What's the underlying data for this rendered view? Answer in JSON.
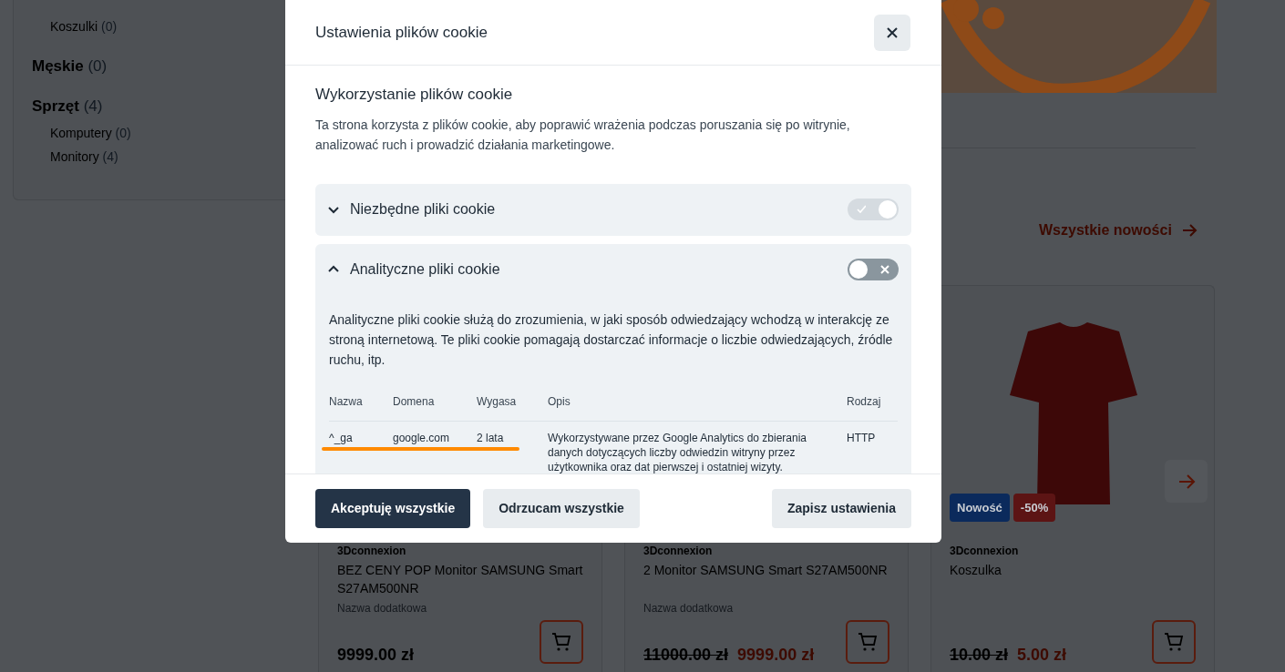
{
  "sidebar": {
    "categories": [
      {
        "children": [
          {
            "label": "Koszulki",
            "count": "(0)"
          }
        ]
      },
      {
        "label": "Męskie",
        "count": "(0)"
      },
      {
        "label": "Sprzęt",
        "count": "(4)",
        "children": [
          {
            "label": "Komputery",
            "count": "(0)"
          },
          {
            "label": "Monitory",
            "count": "(4)"
          }
        ]
      }
    ]
  },
  "new_products": {
    "link": "Wszystkie nowości",
    "products": [
      {
        "brand": "3Dconnexion",
        "name": "BEZ CENY POP Monitor SAMSUNG Smart S27AM500NR",
        "subtitle": "Nazwa dodatkowa",
        "price": "9999.00 zł"
      },
      {
        "brand": "3Dconnexion",
        "name": "2 Monitor SAMSUNG Smart S27AM500NR",
        "subtitle": "Nazwa dodatkowa",
        "old_price": "11000.00 zł",
        "price": "9999.00 zł"
      },
      {
        "brand": "3Dconnexion",
        "name": "Koszulka",
        "old_price": "10.00 zł",
        "price": "5.00 zł",
        "badges": [
          {
            "label": "Nowość",
            "color": "#0b2a5c"
          },
          {
            "label": "-50%",
            "color": "#5c1414"
          }
        ]
      }
    ]
  },
  "cookie_dialog": {
    "title": "Ustawienia plików cookie",
    "heading": "Wykorzystanie plików cookie",
    "intro": "Ta strona korzysta z plików cookie, aby poprawić wrażenia podczas poruszania się po witrynie, analizować ruch i prowadzić działania marketingowe.",
    "categories": [
      {
        "title": "Niezbędne pliki cookie",
        "expanded": false,
        "on": true,
        "disabled": true
      },
      {
        "title": "Analityczne pliki cookie",
        "expanded": true,
        "on": false,
        "disabled": false,
        "description": "Analityczne pliki cookie służą do zrozumienia, w jaki sposób odwiedzający wchodzą w interakcję ze stroną internetową. Te pliki cookie pomagają dostarczać informacje o liczbie odwiedzających, źródle ruchu, itp.",
        "table": {
          "columns": [
            "Nazwa",
            "Domena",
            "Wygasa",
            "Opis",
            "Rodzaj"
          ],
          "rows": [
            {
              "cells": [
                "^_ga",
                "google.com",
                "2 lata",
                "Wykorzystywane przez Google Analytics do zbierania danych dotyczących liczby odwiedzin witryny przez użytkownika oraz dat pierwszej i ostatniej wizyty.",
                "HTTP"
              ],
              "underlined": true
            }
          ]
        }
      }
    ],
    "buttons": [
      {
        "label": "Akceptuję wszystkie",
        "kind": "primary"
      },
      {
        "label": "Odrzucam wszystkie",
        "kind": "secondary"
      },
      {
        "label": "Zapisz ustawienia",
        "kind": "secondary"
      }
    ]
  }
}
